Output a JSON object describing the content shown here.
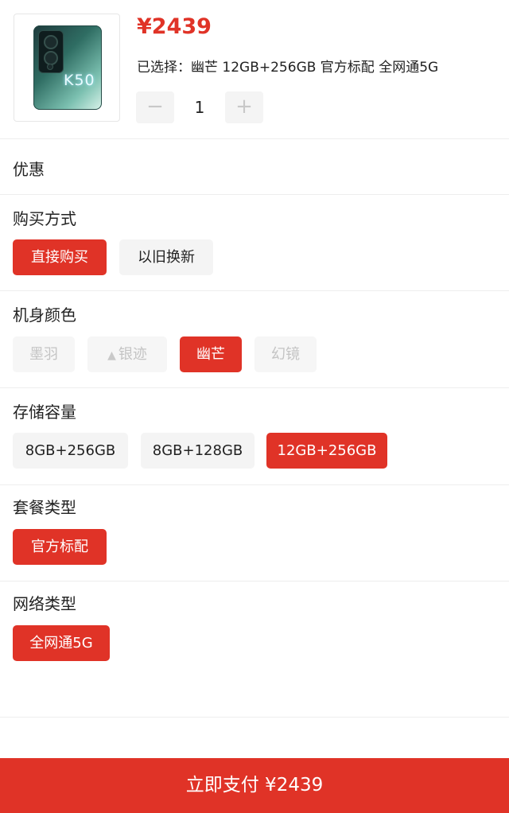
{
  "product": {
    "price": "¥2439",
    "selected_text": "已选择：幽芒 12GB+256GB 官方标配 全网通5G",
    "phone_logo": "K50",
    "quantity": {
      "minus_icon": "−",
      "value": "1",
      "plus_icon": "+"
    }
  },
  "discount": {
    "title": "优惠"
  },
  "purchase_method": {
    "title": "购买方式",
    "options": [
      {
        "label": "直接购买",
        "state": "active"
      },
      {
        "label": "以旧换新",
        "state": "normal"
      }
    ]
  },
  "body_color": {
    "title": "机身颜色",
    "options": [
      {
        "label": "墨羽",
        "state": "disabled"
      },
      {
        "label": "银迹",
        "state": "disabled",
        "icon": "flame-icon",
        "icon_glyph": "🔥"
      },
      {
        "label": "幽芒",
        "state": "active"
      },
      {
        "label": "幻镜",
        "state": "disabled"
      }
    ]
  },
  "storage": {
    "title": "存储容量",
    "options": [
      {
        "label": "8GB+256GB",
        "state": "normal"
      },
      {
        "label": "8GB+128GB",
        "state": "normal"
      },
      {
        "label": "12GB+256GB",
        "state": "active"
      }
    ]
  },
  "package": {
    "title": "套餐类型",
    "options": [
      {
        "label": "官方标配",
        "state": "active"
      }
    ]
  },
  "network": {
    "title": "网络类型",
    "options": [
      {
        "label": "全网通5G",
        "state": "active"
      }
    ]
  },
  "pay_button": {
    "label": "立即支付 ¥2439"
  },
  "colors": {
    "accent": "#e03327",
    "option_bg": "#f4f4f4",
    "disabled_text": "#c4c4c4"
  }
}
